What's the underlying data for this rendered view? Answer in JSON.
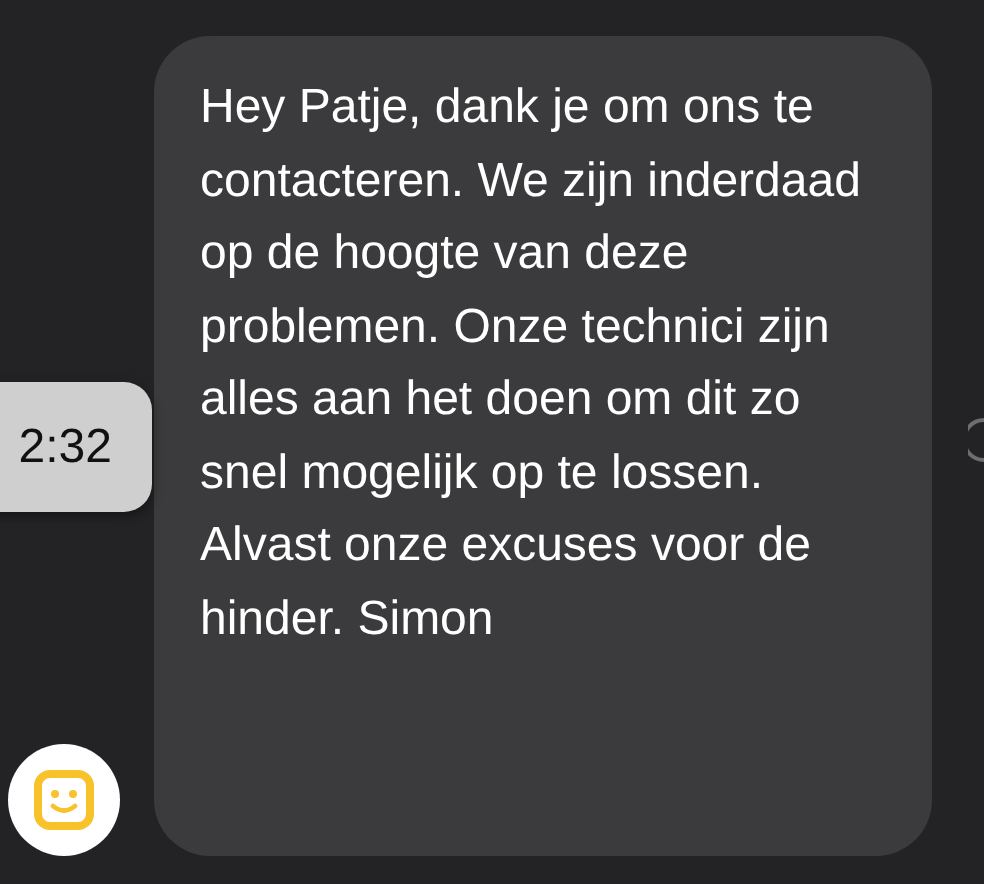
{
  "message": {
    "text": "Hey Patje, dank je om ons te contacteren. We zijn inderdaad op de hoogte van deze problemen. Onze technici zijn alles aan het doen om dit zo snel mogelijk op te lossen. Alvast onze excuses voor de hinder. Simon"
  },
  "timestamp": "2:32"
}
